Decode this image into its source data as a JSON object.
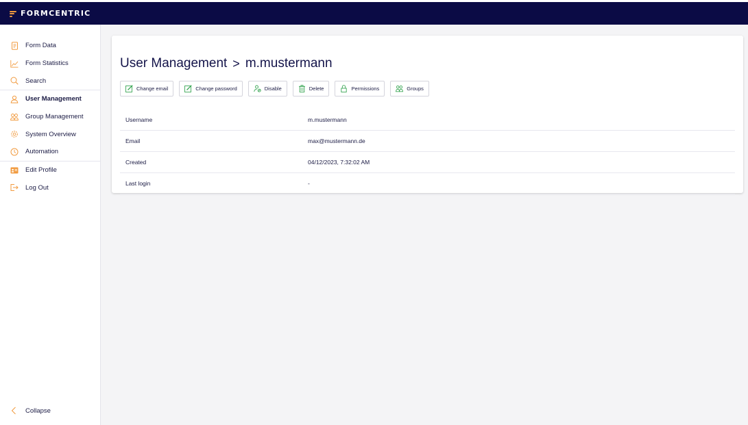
{
  "app": {
    "name": "FORMCENTRIC"
  },
  "colors": {
    "accent": "#f19a3e",
    "topbar": "#0b0b45",
    "text": "#1b1b44"
  },
  "sidebar": {
    "items": [
      {
        "label": "Form Data",
        "icon": "document-icon"
      },
      {
        "label": "Form Statistics",
        "icon": "chart-line-icon"
      },
      {
        "label": "Search",
        "icon": "search-icon"
      },
      {
        "label": "User Management",
        "icon": "user-icon",
        "active": true
      },
      {
        "label": "Group Management",
        "icon": "group-icon"
      },
      {
        "label": "System Overview",
        "icon": "gear-icon"
      },
      {
        "label": "Automation",
        "icon": "clock-icon"
      },
      {
        "label": "Edit Profile",
        "icon": "id-card-icon"
      },
      {
        "label": "Log Out",
        "icon": "logout-icon"
      }
    ],
    "collapse_label": "Collapse"
  },
  "page": {
    "breadcrumb_parent": "User Management",
    "breadcrumb_separator": ">",
    "breadcrumb_current": "m.mustermann"
  },
  "actions": [
    {
      "label": "Change email",
      "icon": "edit-icon"
    },
    {
      "label": "Change password",
      "icon": "edit-icon"
    },
    {
      "label": "Disable",
      "icon": "user-disable-icon"
    },
    {
      "label": "Delete",
      "icon": "trash-icon"
    },
    {
      "label": "Permissions",
      "icon": "lock-icon"
    },
    {
      "label": "Groups",
      "icon": "group-icon"
    }
  ],
  "details": [
    {
      "label": "Username",
      "value": "m.mustermann"
    },
    {
      "label": "Email",
      "value": "max@mustermann.de"
    },
    {
      "label": "Created",
      "value": "04/12/2023, 7:32:02 AM"
    },
    {
      "label": "Last login",
      "value": "-"
    }
  ]
}
